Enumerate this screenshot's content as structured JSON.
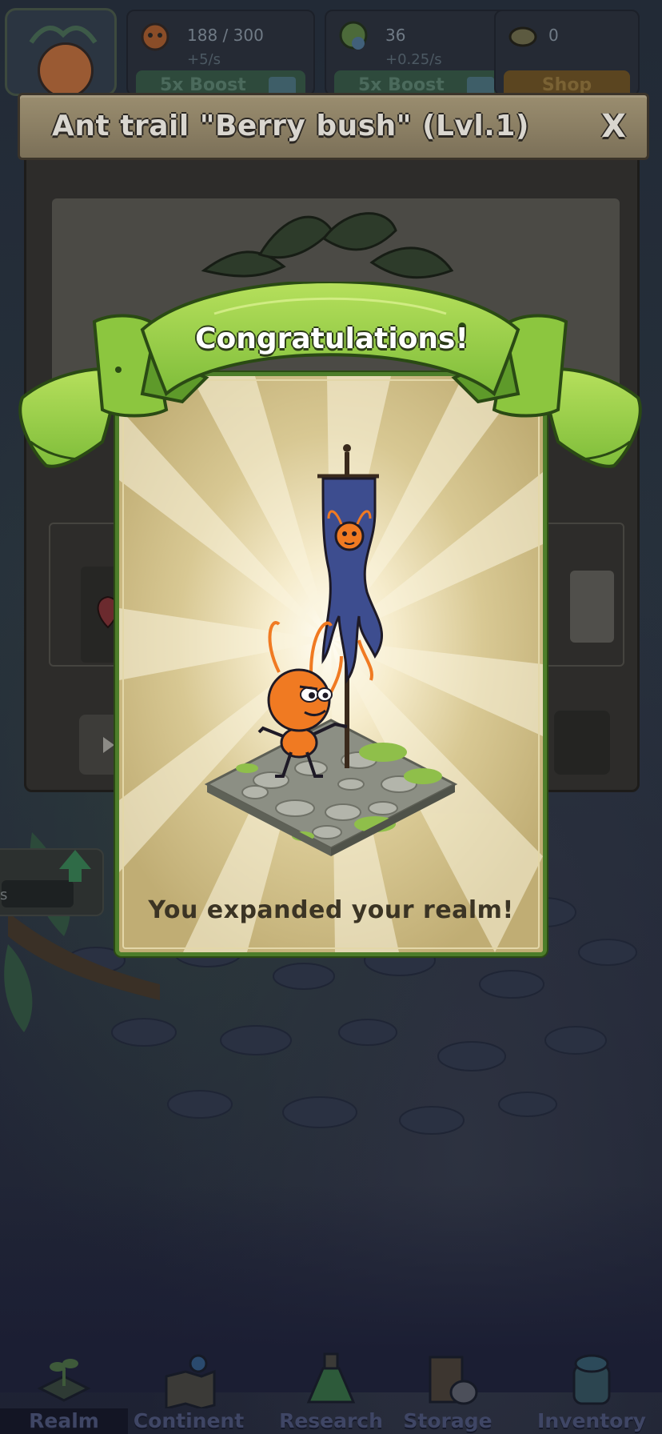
{
  "resources": {
    "ants": {
      "value": "188 / 300",
      "rate": "+5/s",
      "boost_label": "5x Boost"
    },
    "seeds": {
      "value": "36",
      "rate": "+0.25/s",
      "boost_label": "5x Boost"
    },
    "beetles": {
      "value": "0",
      "shop_label": "Shop"
    }
  },
  "dialog": {
    "title": "Ant trail \"Berry bush\" (Lvl.1)",
    "close_label": "X"
  },
  "congrats": {
    "title": "Congratulations!",
    "message": "You expanded your realm!"
  },
  "side_panel": {
    "label": "s"
  },
  "nav": {
    "items": [
      {
        "label": "Realm",
        "icon": "seedling-icon",
        "active": true
      },
      {
        "label": "Continent",
        "icon": "map-icon",
        "active": false
      },
      {
        "label": "Research",
        "icon": "potion-icon",
        "active": false
      },
      {
        "label": "Storage",
        "icon": "box-icon",
        "active": false
      },
      {
        "label": "Inventory",
        "icon": "backpack-icon",
        "active": false
      }
    ]
  },
  "colors": {
    "leaf_green": "#8cc63f",
    "card_gold": "#c2b07b",
    "ant_orange": "#f07a22",
    "banner_blue": "#3b4a8a"
  }
}
